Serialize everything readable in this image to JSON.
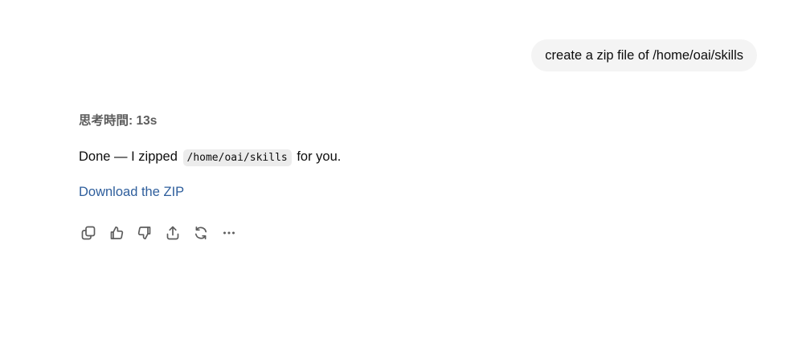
{
  "conversation": {
    "user_message": "create a zip file of /home/oai/skills",
    "assistant": {
      "thinking_label": "思考時間: 13s",
      "reply_prefix": "Done — I zipped",
      "reply_code": "/home/oai/skills",
      "reply_suffix": "for you.",
      "download_link": "Download the ZIP"
    }
  },
  "actions": [
    {
      "name": "copy-button",
      "icon": "copy-icon"
    },
    {
      "name": "thumbs-up-button",
      "icon": "thumbs-up-icon"
    },
    {
      "name": "thumbs-down-button",
      "icon": "thumbs-down-icon"
    },
    {
      "name": "share-button",
      "icon": "share-icon"
    },
    {
      "name": "regenerate-button",
      "icon": "refresh-icon"
    },
    {
      "name": "more-options-button",
      "icon": "more-horizontal-icon"
    }
  ],
  "colors": {
    "link": "#2e5e9c",
    "user_bubble": "#f4f4f4",
    "muted_text": "#5d5d5d"
  }
}
